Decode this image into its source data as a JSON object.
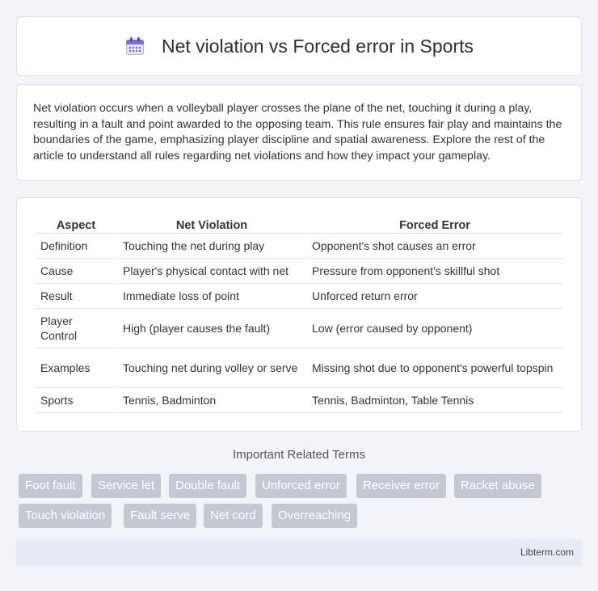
{
  "header": {
    "title": "Net violation vs Forced error in Sports",
    "icon": "calendar-icon"
  },
  "intro": {
    "text": "Net violation occurs when a volleyball player crosses the plane of the net, touching it during a play, resulting in a fault and point awarded to the opposing team. This rule ensures fair play and maintains the boundaries of the game, emphasizing player discipline and spatial awareness. Explore the rest of the article to understand all rules regarding net violations and how they impact your gameplay."
  },
  "table": {
    "headers": [
      "Aspect",
      "Net Violation",
      "Forced Error"
    ],
    "rows": [
      [
        "Definition",
        "Touching the net during play",
        "Opponent's shot causes an error"
      ],
      [
        "Cause",
        "Player's physical contact with net",
        "Pressure from opponent's skillful shot"
      ],
      [
        "Result",
        "Immediate loss of point",
        "Unforced return error"
      ],
      [
        "Player Control",
        "High (player causes the fault)",
        "Low (error caused by opponent)"
      ],
      [
        "Examples",
        "Touching net during volley or serve",
        "Missing shot due to opponent's powerful topspin"
      ],
      [
        "Sports",
        "Tennis, Badminton",
        "Tennis, Badminton, Table Tennis"
      ]
    ]
  },
  "related": {
    "title": "Important Related Terms",
    "tags": [
      "Foot fault",
      "Service let",
      "Double fault",
      "Unforced error",
      "Receiver error",
      "Racket abuse",
      "Touch violation",
      "Fault serve",
      "Net cord",
      "Overreaching"
    ]
  },
  "footer": {
    "site": "Libterm.com"
  }
}
